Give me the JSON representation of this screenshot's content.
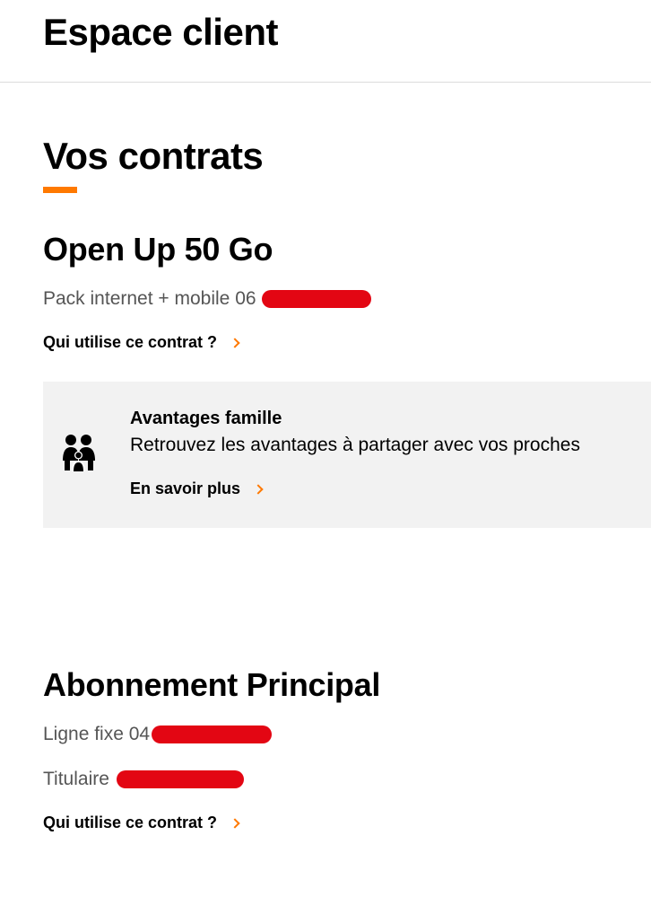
{
  "header": {
    "title": "Espace client"
  },
  "section": {
    "title": "Vos contrats"
  },
  "colors": {
    "accent": "#ff7900",
    "redaction": "#e30613",
    "card_bg": "#f2f2f2"
  },
  "contract1": {
    "title": "Open Up 50 Go",
    "line": "Pack internet + mobile 06",
    "users_link": "Qui utilise ce contrat ?"
  },
  "family_card": {
    "icon": "family-icon",
    "title": "Avantages famille",
    "description": "Retrouvez les avantages à partager avec vos proches",
    "link": "En savoir plus"
  },
  "contract2": {
    "title": "Abonnement Principal",
    "line": "Ligne fixe 04",
    "holder": "Titulaire",
    "users_link": "Qui utilise ce contrat ?"
  }
}
